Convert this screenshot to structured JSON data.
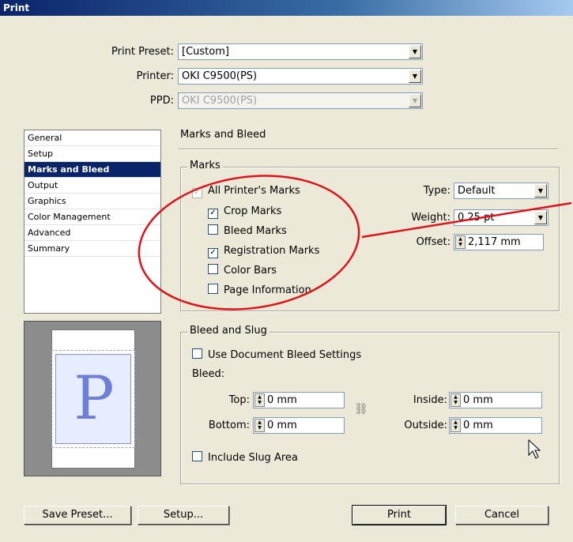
{
  "window": {
    "title": "Print"
  },
  "top": {
    "preset_label": "Print Preset:",
    "preset_value": "[Custom]",
    "printer_label": "Printer:",
    "printer_value": "OKI C9500(PS)",
    "ppd_label": "PPD:",
    "ppd_value": "OKI C9500(PS)"
  },
  "sidebar": {
    "items": [
      {
        "label": "General"
      },
      {
        "label": "Setup"
      },
      {
        "label": "Marks and Bleed"
      },
      {
        "label": "Output"
      },
      {
        "label": "Graphics"
      },
      {
        "label": "Color Management"
      },
      {
        "label": "Advanced"
      },
      {
        "label": "Summary"
      }
    ]
  },
  "preview": {
    "letter": "P"
  },
  "panel": {
    "title": "Marks and Bleed",
    "marks": {
      "legend": "Marks",
      "all_printers_marks": "All Printer's Marks",
      "crop_marks": "Crop Marks",
      "bleed_marks": "Bleed Marks",
      "registration_marks": "Registration Marks",
      "color_bars": "Color Bars",
      "page_information": "Page Information",
      "type_label": "Type:",
      "type_value": "Default",
      "weight_label": "Weight:",
      "weight_value": "0.25 pt",
      "offset_label": "Offset:",
      "offset_value": "2,117 mm"
    },
    "bleed": {
      "legend": "Bleed and Slug",
      "use_document": "Use Document Bleed Settings",
      "bleed_label": "Bleed:",
      "top_label": "Top:",
      "top_value": "0 mm",
      "bottom_label": "Bottom:",
      "bottom_value": "0 mm",
      "inside_label": "Inside:",
      "inside_value": "0 mm",
      "outside_label": "Outside:",
      "outside_value": "0 mm",
      "include_slug": "Include Slug Area"
    }
  },
  "buttons": {
    "save_preset": "Save Preset...",
    "setup": "Setup...",
    "print": "Print",
    "cancel": "Cancel"
  },
  "annotation_color": "#e0131a"
}
